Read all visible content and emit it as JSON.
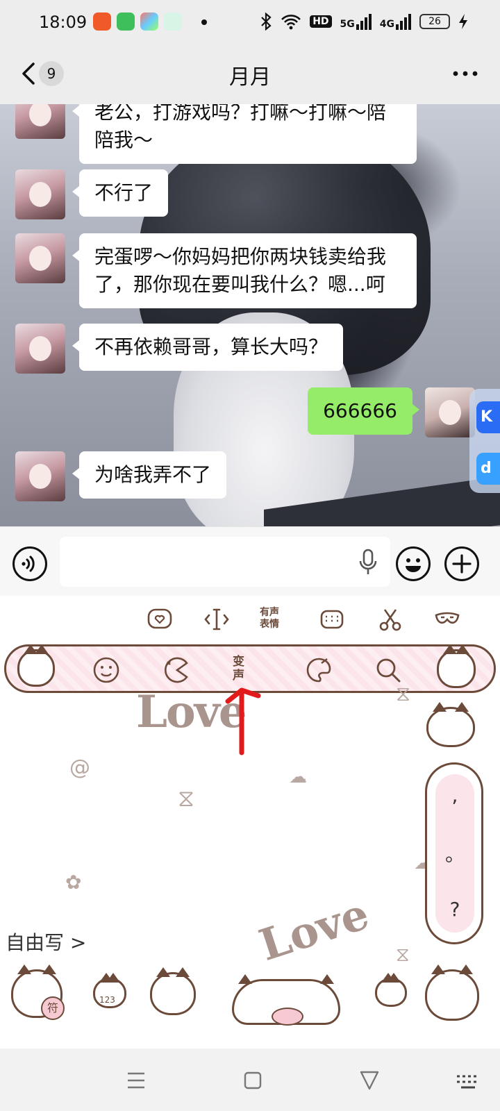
{
  "status_bar": {
    "time": "18:09",
    "hd_label": "HD",
    "signal_1_label": "5G",
    "signal_2_label": "4G",
    "battery": "26"
  },
  "header": {
    "unread_count": "9",
    "title": "月月"
  },
  "messages": [
    {
      "side": "left",
      "text": "老公，打游戏吗？打嘛～打嘛～陪陪我～"
    },
    {
      "side": "left",
      "text": "不行了"
    },
    {
      "side": "left",
      "text": "完蛋啰～你妈妈把你两块钱卖给我了，那你现在要叫我什么？嗯...呵"
    },
    {
      "side": "left",
      "text": "不再依赖哥哥，算长大吗？"
    },
    {
      "side": "right",
      "text": "666666"
    },
    {
      "side": "left",
      "text": "为啥我弄不了"
    }
  ],
  "side_float": {
    "k_label": "K",
    "d_label": "d"
  },
  "input_bar": {
    "placeholder": ""
  },
  "keyboard": {
    "toolbar": {
      "voice_emoji_label": "有声\n表情"
    },
    "pink_bar": {
      "voice_change_label": "变\n声"
    },
    "love_text_top": "Love",
    "love_text_bottom": "Love",
    "punctuation": [
      ",",
      "。",
      "?"
    ],
    "free_write_label": "自由写 >",
    "stickers": [
      {
        "label": "符"
      },
      {
        "label": "123"
      }
    ]
  },
  "colors": {
    "brand_green": "#95ec69",
    "background": "#ededed",
    "bubble_white": "#ffffff",
    "keyboard_pink": "#fbe4ea",
    "keyboard_brown": "#6b4a3a",
    "arrow_red": "#e11b1b"
  }
}
